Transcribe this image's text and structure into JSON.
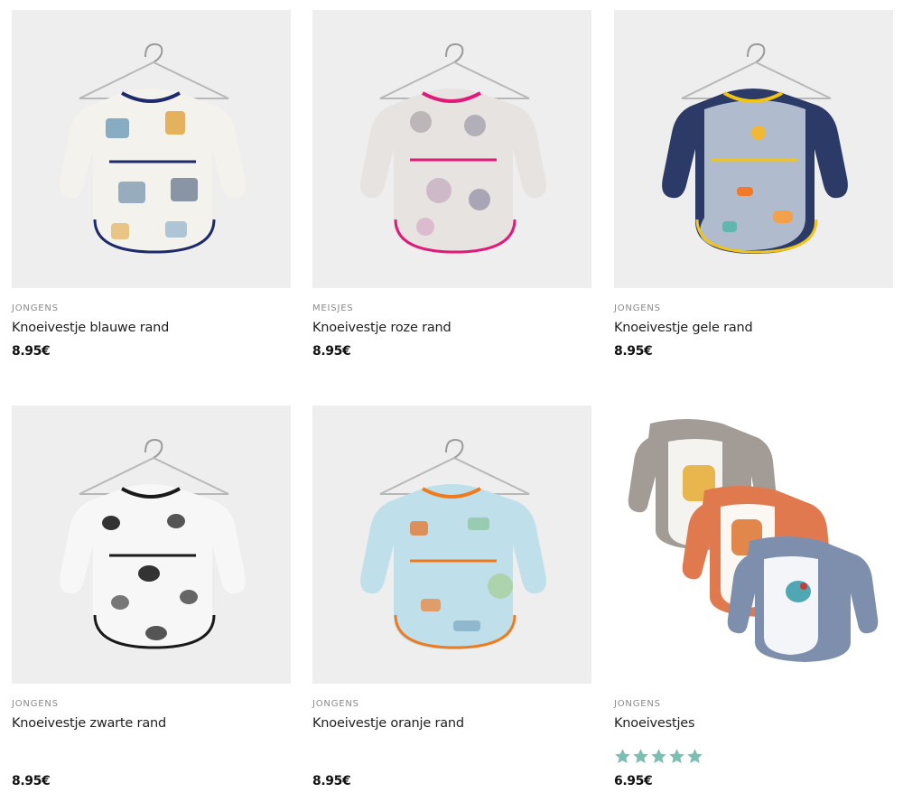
{
  "products": [
    {
      "category": "JONGENS",
      "title": "Knoeivestje blauwe rand",
      "price": "8.95€",
      "trim_color": "#1e2a6b",
      "body_color": "#f4f2ec"
    },
    {
      "category": "MEISJES",
      "title": "Knoeivestje roze rand",
      "price": "8.95€",
      "trim_color": "#e0197a",
      "body_color": "#e7e3e0"
    },
    {
      "category": "JONGENS",
      "title": "Knoeivestje gele rand",
      "price": "8.95€",
      "trim_color": "#f2c414",
      "body_color": "#c8d3e0"
    },
    {
      "category": "JONGENS",
      "title": "Knoeivestje zwarte rand",
      "price": "8.95€",
      "trim_color": "#1a1a1a",
      "body_color": "#f7f7f7"
    },
    {
      "category": "JONGENS",
      "title": "Knoeivestje oranje rand",
      "price": "8.95€",
      "trim_color": "#f07a1e",
      "body_color": "#bfe0ea"
    },
    {
      "category": "JONGENS",
      "title": "Knoeivestjes",
      "price": "6.95€",
      "rating": 5,
      "star_color": "#7bbfb3"
    }
  ]
}
